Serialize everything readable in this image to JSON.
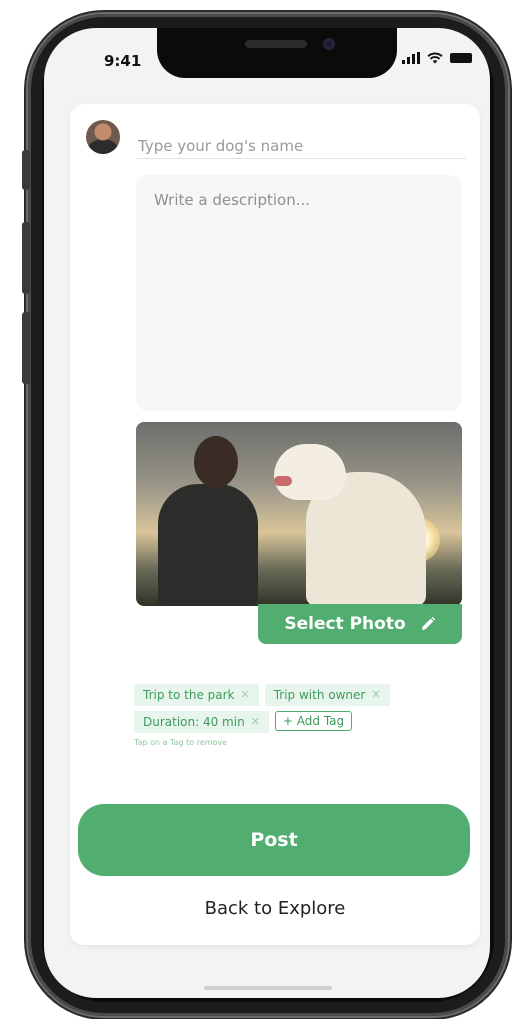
{
  "status_bar": {
    "time": "9:41"
  },
  "form": {
    "name_placeholder": "Type your dog's name",
    "description_placeholder": "Write a description...",
    "select_photo_label": "Select Photo",
    "tags": [
      {
        "label": "Trip to the park"
      },
      {
        "label": "Trip with owner"
      },
      {
        "label": "Duration: 40 min"
      }
    ],
    "add_tag_label": "+ Add Tag",
    "tag_hint": "Tap on a Tag to remove",
    "post_label": "Post",
    "back_label": "Back to Explore"
  },
  "colors": {
    "accent": "#52ad70",
    "tag_bg": "#e8f5ec"
  },
  "icons": [
    "signal-icon",
    "wifi-icon",
    "battery-icon",
    "pencil-icon",
    "close-icon"
  ]
}
